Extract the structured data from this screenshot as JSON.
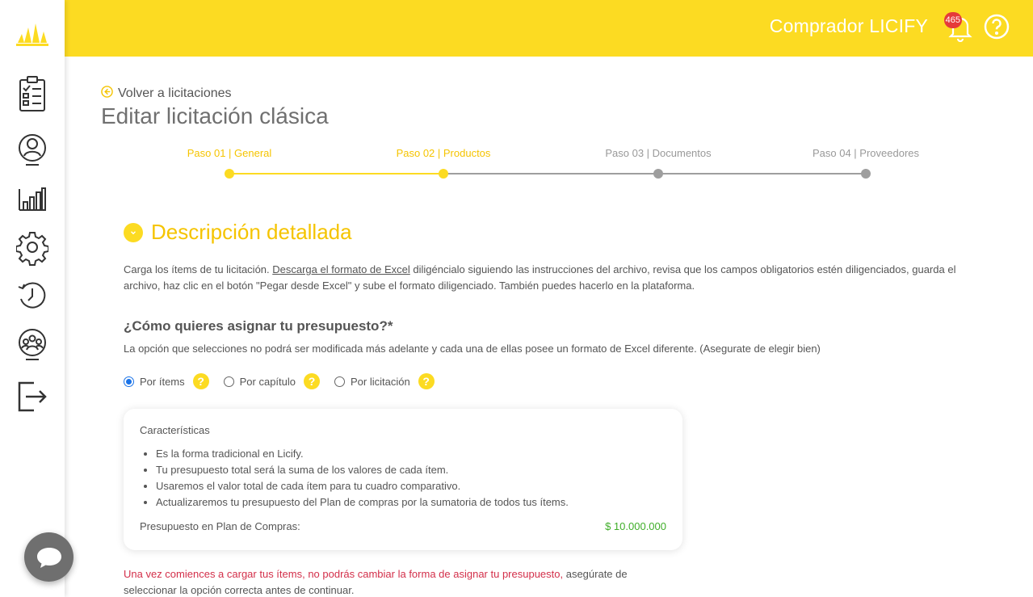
{
  "header": {
    "user_name": "Comprador LICIFY",
    "notification_count": "465",
    "brand_color": "#fcdb22"
  },
  "sidebar": {
    "items": [
      {
        "icon": "checklist-icon"
      },
      {
        "icon": "user-profile-icon"
      },
      {
        "icon": "bar-chart-icon"
      },
      {
        "icon": "gear-icon"
      },
      {
        "icon": "history-icon"
      },
      {
        "icon": "group-icon"
      },
      {
        "icon": "logout-icon"
      }
    ]
  },
  "page": {
    "back_link": "Volver a licitaciones",
    "title": "Editar licitación clásica"
  },
  "stepper": {
    "steps": [
      {
        "label": "Paso 01 | General",
        "state": "active"
      },
      {
        "label": "Paso 02 | Productos",
        "state": "active"
      },
      {
        "label": "Paso 03 | Documentos",
        "state": "inactive"
      },
      {
        "label": "Paso 04 | Proveedores",
        "state": "inactive"
      }
    ],
    "active_color": "#fcdb22",
    "inactive_color": "#9e9e9e"
  },
  "section": {
    "title": "Descripción detallada",
    "desc_prefix": "Carga los ítems de tu licitación. ",
    "desc_link": "Descarga el formato de Excel",
    "desc_suffix": " diligéncialo siguiendo las instrucciones del archivo, revisa que los campos obligatorios estén diligenciados, guarda el archivo, haz clic en el botón \"Pegar desde Excel\" y sube el formato diligenciado. También puedes hacerlo en la plataforma.",
    "question": "¿Cómo quieres asignar tu presupuesto?*",
    "question_note": "La opción que selecciones no podrá ser modificada más adelante y cada una de ellas posee un formato de Excel diferente. (Asegurate de elegir bien)",
    "options": [
      {
        "label": "Por ítems",
        "checked": true
      },
      {
        "label": "Por capítulo",
        "checked": false
      },
      {
        "label": "Por licitación",
        "checked": false
      }
    ]
  },
  "card": {
    "title": "Características",
    "bullets": [
      "Es la forma tradicional en Licify.",
      "Tu presupuesto total será la suma de los valores de cada ítem.",
      "Usaremos el valor total de cada ítem para tu cuadro comparativo.",
      "Actualizaremos tu presupuesto del Plan de compras por la sumatoria de todos tus ítems."
    ],
    "budget_label": "Presupuesto en Plan de Compras:",
    "budget_value": "$ 10.000.000"
  },
  "warning": {
    "red_text": "Una vez comiences a cargar tus ítems, no podrás cambiar la forma de asignar tu presupuesto,",
    "rest_text": " asegúrate de seleccionar la opción correcta antes de continuar."
  }
}
